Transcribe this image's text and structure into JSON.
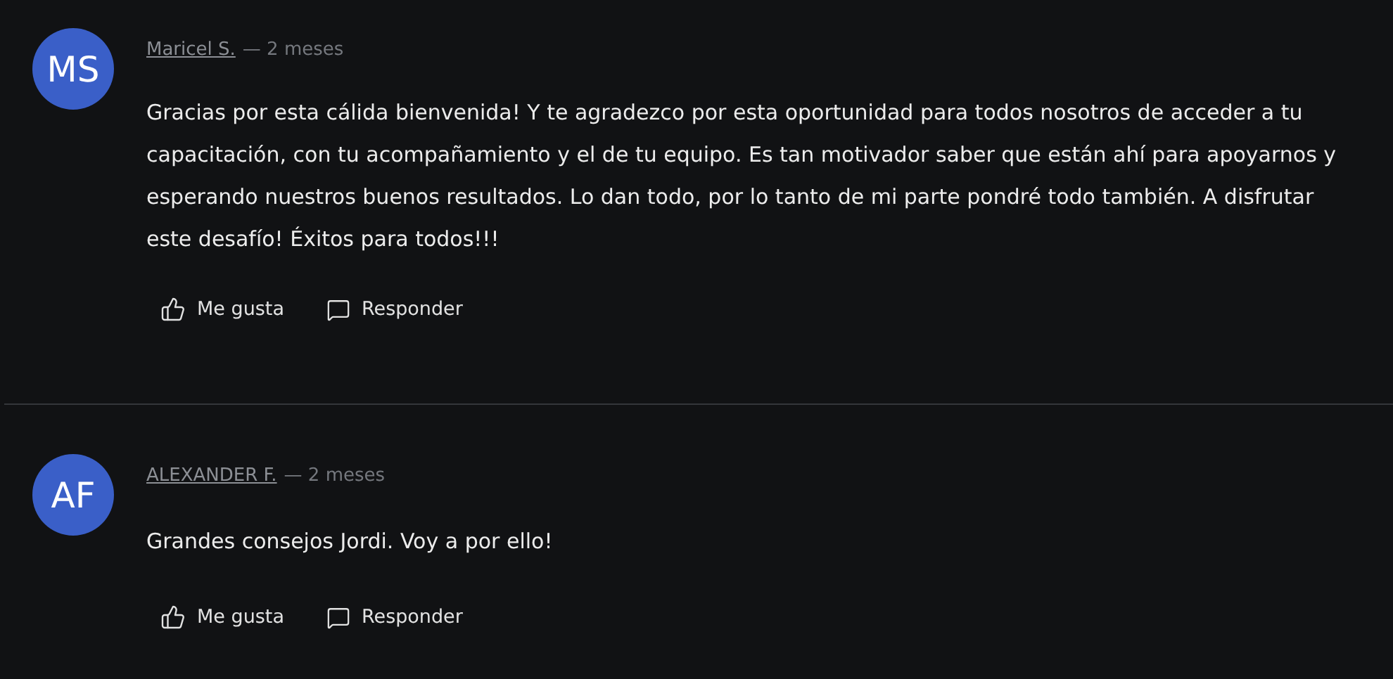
{
  "comments": [
    {
      "initials": "MS",
      "author": "Maricel S.",
      "time": "— 2 meses",
      "text": "Gracias por esta cálida bienvenida! Y te agradezco por esta oportunidad para todos nosotros de acceder a tu capacitación, con tu acompañamiento y el de tu equipo. Es tan motivador saber que están ahí para apoyarnos y esperando nuestros buenos resultados. Lo dan todo, por lo tanto de mi parte pondré todo también. A disfrutar este desafío! Éxitos para todos!!!",
      "like": "Me gusta",
      "reply": "Responder"
    },
    {
      "initials": "AF",
      "author": "ALEXANDER F.",
      "time": "— 2 meses",
      "text": "Grandes consejos Jordi. Voy a por ello!",
      "like": "Me gusta",
      "reply": "Responder"
    }
  ]
}
